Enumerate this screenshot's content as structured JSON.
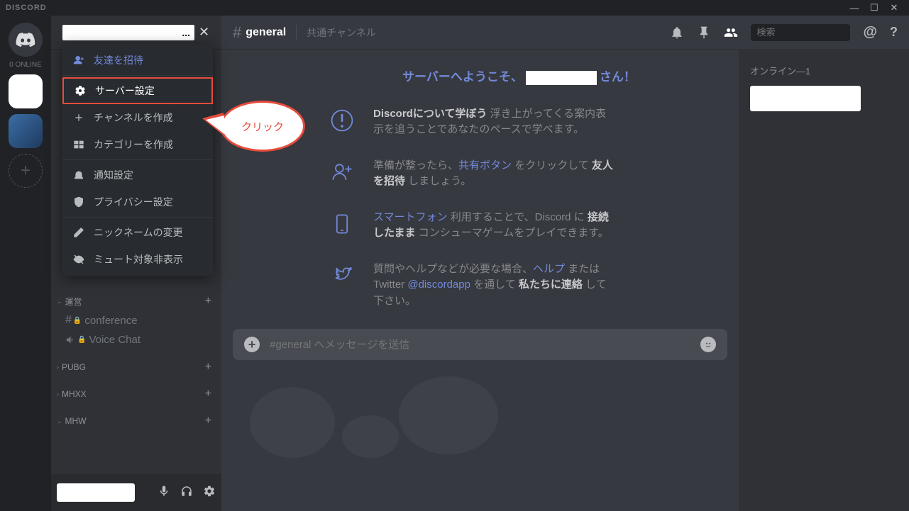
{
  "app_name": "DISCORD",
  "online_label": "0 ONLINE",
  "server_name_suffix": "...",
  "channel_header": {
    "name": "general",
    "topic": "共通チャンネル",
    "search_placeholder": "検索"
  },
  "dropdown": {
    "invite": "友達を招待",
    "server_settings": "サーバー設定",
    "create_channel": "チャンネルを作成",
    "create_category": "カテゴリーを作成",
    "notification": "通知設定",
    "privacy": "プライバシー設定",
    "nickname": "ニックネームの変更",
    "hide_muted": "ミュート対象非表示"
  },
  "callout_text": "クリック",
  "categories": [
    {
      "name": "運営",
      "channels": [
        {
          "name": "conference",
          "type": "text",
          "locked": true
        },
        {
          "name": "Voice Chat",
          "type": "voice",
          "locked": true
        }
      ]
    },
    {
      "name": "PUBG",
      "channels": []
    },
    {
      "name": "MHXX",
      "channels": []
    },
    {
      "name": "MHW",
      "channels": []
    }
  ],
  "welcome": {
    "title_pre": "サーバーへようこそ、",
    "title_post": "さん",
    "title_excl": "！",
    "items": [
      {
        "b1": "Discordについて学ぼう",
        "t1": " 浮き上がってくる案内表示を追うことであなたのペースで学べます。"
      },
      {
        "t1": "準備が整ったら、",
        "l1": "共有ボタン",
        "t2": " をクリックして ",
        "b1": "友人を招待",
        "t3": " しましょう。"
      },
      {
        "l1": "スマートフォン",
        "t1": " 利用することで、Discord に ",
        "b1": "接続したまま",
        "t2": " コンシューマゲームをプレイできます。"
      },
      {
        "t1": "質問やヘルプなどが必要な場合、",
        "l1": "ヘルプ",
        "t2": " または Twitter ",
        "l2": "@discordapp",
        "t3": " を通して ",
        "b1": "私たちに連絡",
        "t4": " して下さい。"
      }
    ]
  },
  "message_placeholder": "#general へメッセージを送信",
  "members_header": "オンライン—1"
}
